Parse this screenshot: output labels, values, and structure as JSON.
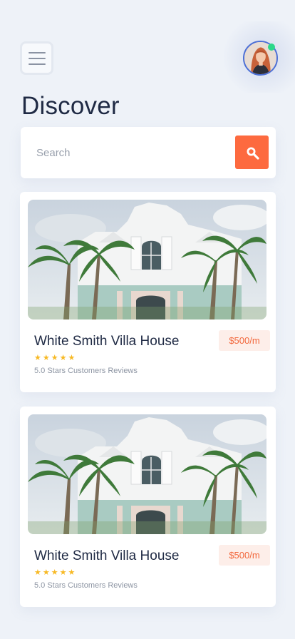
{
  "header": {
    "menu_icon": "hamburger-icon",
    "avatar": "user-avatar",
    "online": true
  },
  "page_title": "Discover",
  "search": {
    "placeholder": "Search",
    "value": "",
    "button_icon": "search-icon"
  },
  "colors": {
    "accent": "#fd6a3f",
    "background": "#eef2f8",
    "status_online": "#2bd88a",
    "star": "#f7b924",
    "price_bg": "#fdeee9"
  },
  "listings": [
    {
      "title": "White Smith Villa House",
      "price": "$500/m",
      "rating_stars": 5,
      "reviews": "5.0 Stars Customers Reviews"
    },
    {
      "title": "White Smith Villa House",
      "price": "$500/m",
      "rating_stars": 5,
      "reviews": "5.0 Stars Customers Reviews"
    }
  ]
}
